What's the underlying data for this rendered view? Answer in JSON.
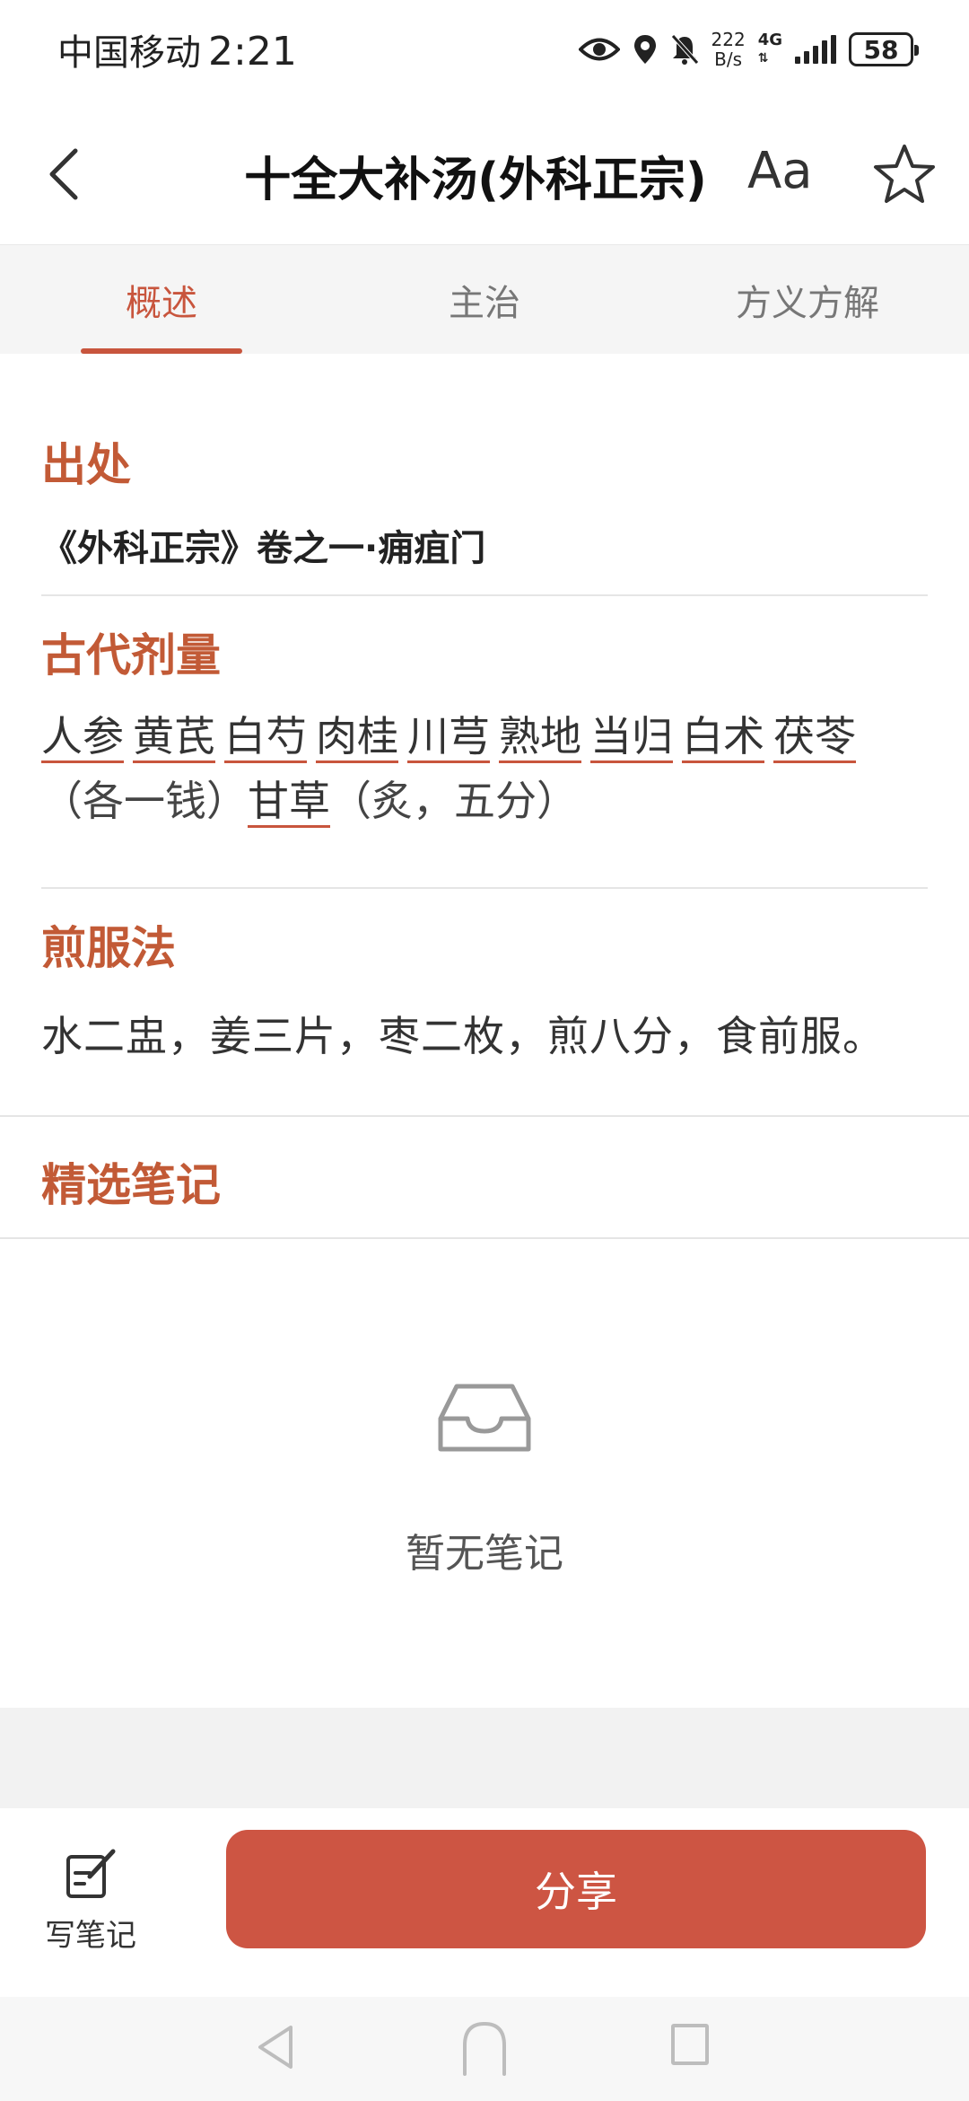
{
  "status_bar": {
    "carrier": "中国移动",
    "time": "2:21",
    "net_speed_value": "222",
    "net_speed_unit": "B/s",
    "network": "4G",
    "battery": "58"
  },
  "header": {
    "title": "十全大补汤(外科正宗)",
    "font_size_label": "Aa"
  },
  "tabs": [
    {
      "label": "概述",
      "active": true
    },
    {
      "label": "主治",
      "active": false
    },
    {
      "label": "方义方解",
      "active": false
    }
  ],
  "source": {
    "title": "出处",
    "text": "《外科正宗》卷之一·痈疽门"
  },
  "dosage": {
    "title": "古代剂量",
    "herbs_group1": [
      "人参",
      "黄芪",
      "白芍",
      "肉桂",
      "川芎",
      "熟地",
      "当归",
      "白术",
      "茯苓"
    ],
    "note1": "（各一钱）",
    "herbs_group2": [
      "甘草"
    ],
    "note2": "（炙，五分）"
  },
  "method": {
    "title": "煎服法",
    "text": "水二盅，姜三片，枣二枚，煎八分，食前服。"
  },
  "notes": {
    "title": "精选笔记",
    "empty_text": "暂无笔记"
  },
  "bottom_bar": {
    "write_note_label": "写笔记",
    "share_label": "分享"
  },
  "colors": {
    "accent": "#c8553d",
    "share_button": "#cd5543"
  }
}
